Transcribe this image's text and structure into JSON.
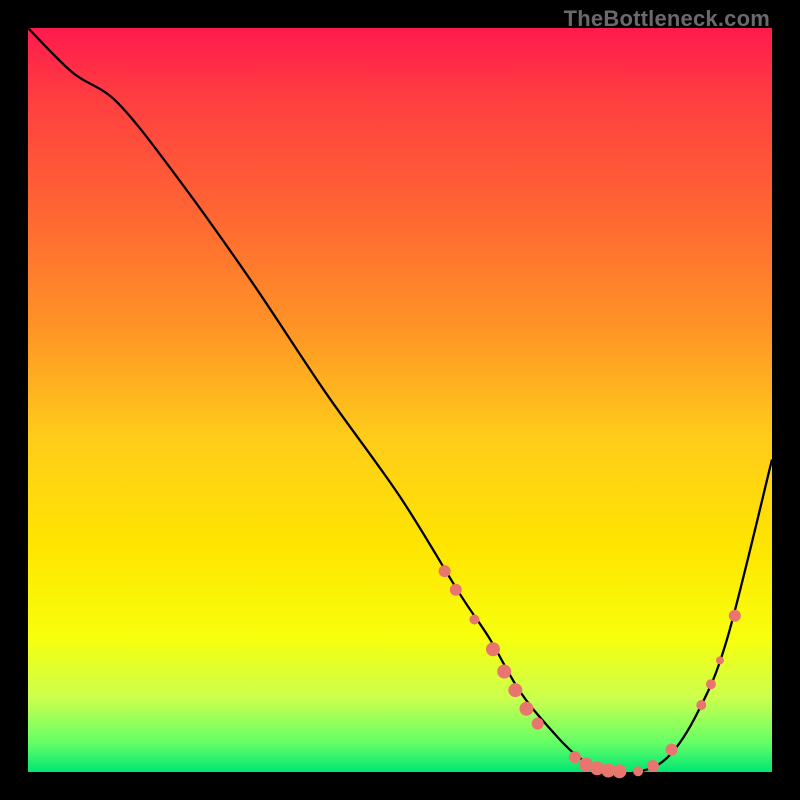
{
  "watermark": "TheBottleneck.com",
  "chart_data": {
    "type": "line",
    "title": "",
    "xlabel": "",
    "ylabel": "",
    "xlim": [
      0,
      100
    ],
    "ylim": [
      0,
      100
    ],
    "curve": {
      "x": [
        0,
        6,
        12,
        20,
        30,
        40,
        50,
        58,
        62,
        66,
        70,
        74,
        78,
        82,
        86,
        90,
        94,
        100
      ],
      "height": [
        100,
        94,
        90,
        80,
        66,
        51,
        37,
        24,
        18,
        11,
        6,
        2,
        0,
        0,
        2,
        8,
        18,
        42
      ]
    },
    "markers": [
      {
        "x": 56.0,
        "height": 27.0,
        "r": 6
      },
      {
        "x": 57.5,
        "height": 24.5,
        "r": 6
      },
      {
        "x": 60.0,
        "height": 20.5,
        "r": 5
      },
      {
        "x": 62.5,
        "height": 16.5,
        "r": 7
      },
      {
        "x": 64.0,
        "height": 13.5,
        "r": 7
      },
      {
        "x": 65.5,
        "height": 11.0,
        "r": 7
      },
      {
        "x": 67.0,
        "height": 8.5,
        "r": 7
      },
      {
        "x": 68.5,
        "height": 6.5,
        "r": 6
      },
      {
        "x": 73.5,
        "height": 2.0,
        "r": 6
      },
      {
        "x": 75.0,
        "height": 1.0,
        "r": 7
      },
      {
        "x": 76.5,
        "height": 0.5,
        "r": 7
      },
      {
        "x": 78.0,
        "height": 0.2,
        "r": 7
      },
      {
        "x": 79.5,
        "height": 0.1,
        "r": 7
      },
      {
        "x": 82.0,
        "height": 0.1,
        "r": 5
      },
      {
        "x": 84.0,
        "height": 0.8,
        "r": 6
      },
      {
        "x": 86.5,
        "height": 3.0,
        "r": 6
      },
      {
        "x": 90.5,
        "height": 9.0,
        "r": 5
      },
      {
        "x": 91.8,
        "height": 11.8,
        "r": 5
      },
      {
        "x": 93.0,
        "height": 15.0,
        "r": 4
      },
      {
        "x": 95.0,
        "height": 21.0,
        "r": 6
      }
    ]
  }
}
